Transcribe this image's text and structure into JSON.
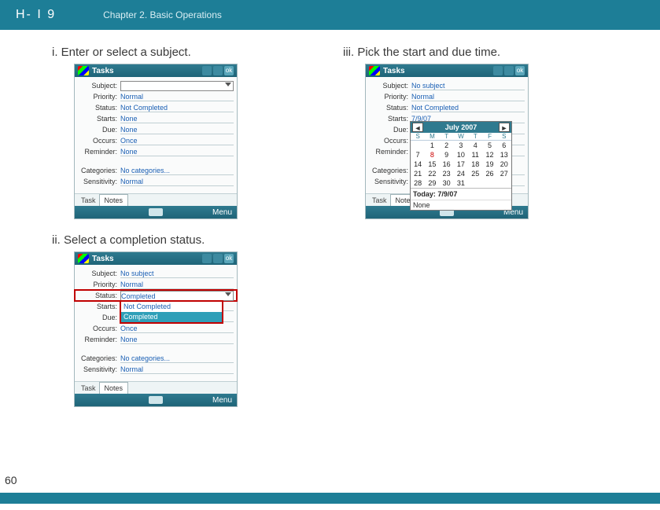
{
  "header": {
    "logo": "H- I 9",
    "chapter": "Chapter 2. Basic Operations"
  },
  "page_number": "60",
  "steps": {
    "i": {
      "caption": "i. Enter or select a subject."
    },
    "ii": {
      "caption": "ii. Select a completion status."
    },
    "iii": {
      "caption": "iii. Pick the start and due time."
    }
  },
  "labels": {
    "subject": "Subject:",
    "priority": "Priority:",
    "status": "Status:",
    "starts": "Starts:",
    "due": "Due:",
    "occurs": "Occurs:",
    "reminder": "Reminder:",
    "categories": "Categories:",
    "sensitivity": "Sensitivity:",
    "task": "Task",
    "notes": "Notes",
    "menu": "Menu",
    "tasks_title": "Tasks",
    "ok": "ok"
  },
  "shot1": {
    "subject": "",
    "priority": "Normal",
    "status": "Not Completed",
    "starts": "None",
    "due": "None",
    "occurs": "Once",
    "reminder": "None",
    "categories": "No categories...",
    "sensitivity": "Normal"
  },
  "shot2": {
    "subject": "No subject",
    "priority": "Normal",
    "status": "Completed",
    "drop_opt1": "Not Completed",
    "drop_opt2": "Completed",
    "starts": "",
    "due": "",
    "occurs": "Once",
    "reminder": "None",
    "categories": "No categories...",
    "sensitivity": "Normal"
  },
  "shot3": {
    "subject": "No subject",
    "priority": "Normal",
    "status": "Not Completed",
    "starts": "7/9/07",
    "due": "",
    "occurs": "",
    "reminder": "",
    "categories": "",
    "sensitivity": ""
  },
  "calendar": {
    "month": "July 2007",
    "dow": [
      "S",
      "M",
      "T",
      "W",
      "T",
      "F",
      "S"
    ],
    "grid": [
      "",
      "1",
      "2",
      "3",
      "4",
      "5",
      "6",
      "7",
      "8",
      "9",
      "10",
      "11",
      "12",
      "13",
      "14",
      "15",
      "16",
      "17",
      "18",
      "19",
      "20",
      "21",
      "22",
      "23",
      "24",
      "25",
      "26",
      "27",
      "28",
      "29",
      "30",
      "31"
    ],
    "today": "Today: 7/9/07",
    "none": "None"
  }
}
